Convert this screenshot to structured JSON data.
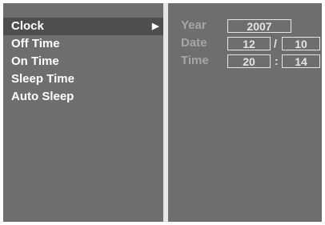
{
  "menu": {
    "items": [
      {
        "label": "Clock"
      },
      {
        "label": "Off Time"
      },
      {
        "label": "On Time"
      },
      {
        "label": "Sleep Time"
      },
      {
        "label": "Auto Sleep"
      }
    ],
    "arrow": "▶"
  },
  "clock": {
    "year_label": "Year",
    "year": "2007",
    "date_label": "Date",
    "month": "12",
    "date_sep": "/",
    "day": "10",
    "time_label": "Time",
    "hour": "20",
    "time_sep": ":",
    "minute": "14"
  }
}
